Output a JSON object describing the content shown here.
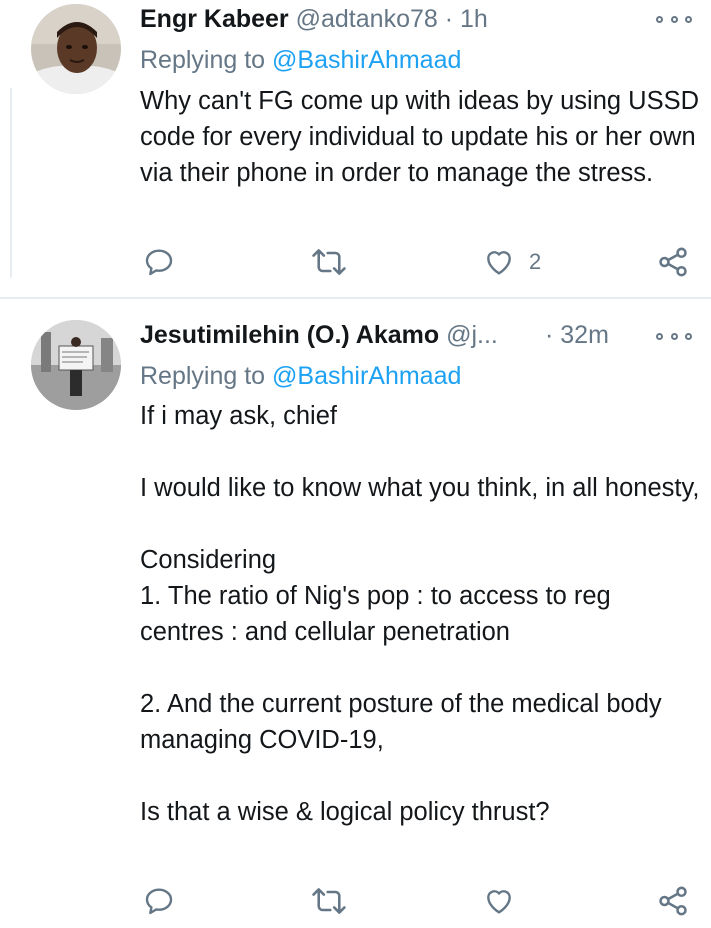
{
  "tweets": [
    {
      "name": "Engr Kabeer",
      "handle": "@adtanko78",
      "separator": "·",
      "time": "1h",
      "replying_prefix": "Replying to",
      "replying_to": "@BashirAhmaad",
      "body": [
        "Why can't FG come up with ideas by using USSD code for every individual to update his or her own via their phone in order to manage the stress."
      ],
      "like_count": "2"
    },
    {
      "name": "Jesutimilehin (O.) Akamo",
      "handle": "@j...",
      "separator": "·",
      "time": "32m",
      "replying_prefix": "Replying to",
      "replying_to": "@BashirAhmaad",
      "body": [
        "If i may ask, chief",
        "",
        "I would like to know what you think, in all honesty,",
        "",
        "Considering",
        "1. The ratio of Nig's pop : to access to reg centres : and cellular penetration",
        "",
        "2. And the current posture of the medical body managing COVID-19,",
        "",
        "Is that a wise & logical policy thrust?"
      ],
      "like_count": ""
    }
  ],
  "icons": {
    "reply": "reply-icon",
    "retweet": "retweet-icon",
    "like": "heart-icon",
    "share": "share-icon",
    "more": "more-options-icon"
  },
  "colors": {
    "text": "#14171a",
    "secondary": "#657786",
    "link": "#1da1f2",
    "divider": "#e6ecf0"
  }
}
